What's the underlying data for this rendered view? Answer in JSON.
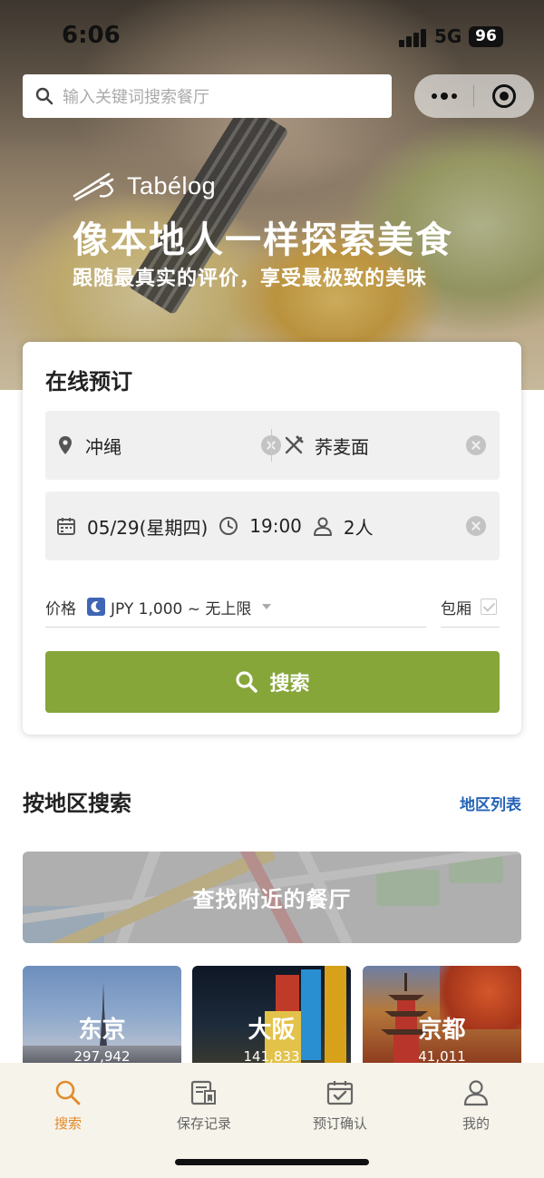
{
  "status_bar": {
    "time": "6:06",
    "network": "5G",
    "battery": "96"
  },
  "search": {
    "placeholder": "输入关键词搜索餐厅"
  },
  "hero": {
    "brand": "Tabélog",
    "headline": "像本地人一样探索美食",
    "subline": "跟随最真实的评价，享受最极致的美味"
  },
  "booking": {
    "title": "在线预订",
    "location": "冲绳",
    "cuisine": "荞麦面",
    "date": "05/29(星期四)",
    "time": "19:00",
    "party": "2人",
    "price_label": "价格",
    "price_value": "JPY 1,000 ~ 无上限",
    "private_room_label": "包厢",
    "private_room_checked": true,
    "search_button": "搜索",
    "accent_color": "#86a63a"
  },
  "region": {
    "title": "按地区搜索",
    "link": "地区列表",
    "nearby_label": "查找附近的餐厅",
    "cities": [
      {
        "name": "东京",
        "count": "297,942"
      },
      {
        "name": "大阪",
        "count": "141,833"
      },
      {
        "name": "京都",
        "count": "41,011"
      }
    ]
  },
  "tabbar": {
    "active_color": "#e28a2b",
    "items": [
      {
        "label": "搜索",
        "icon": "search-icon",
        "active": true
      },
      {
        "label": "保存记录",
        "icon": "saved-list-icon",
        "active": false
      },
      {
        "label": "预订确认",
        "icon": "calendar-check-icon",
        "active": false
      },
      {
        "label": "我的",
        "icon": "user-icon",
        "active": false
      }
    ]
  }
}
